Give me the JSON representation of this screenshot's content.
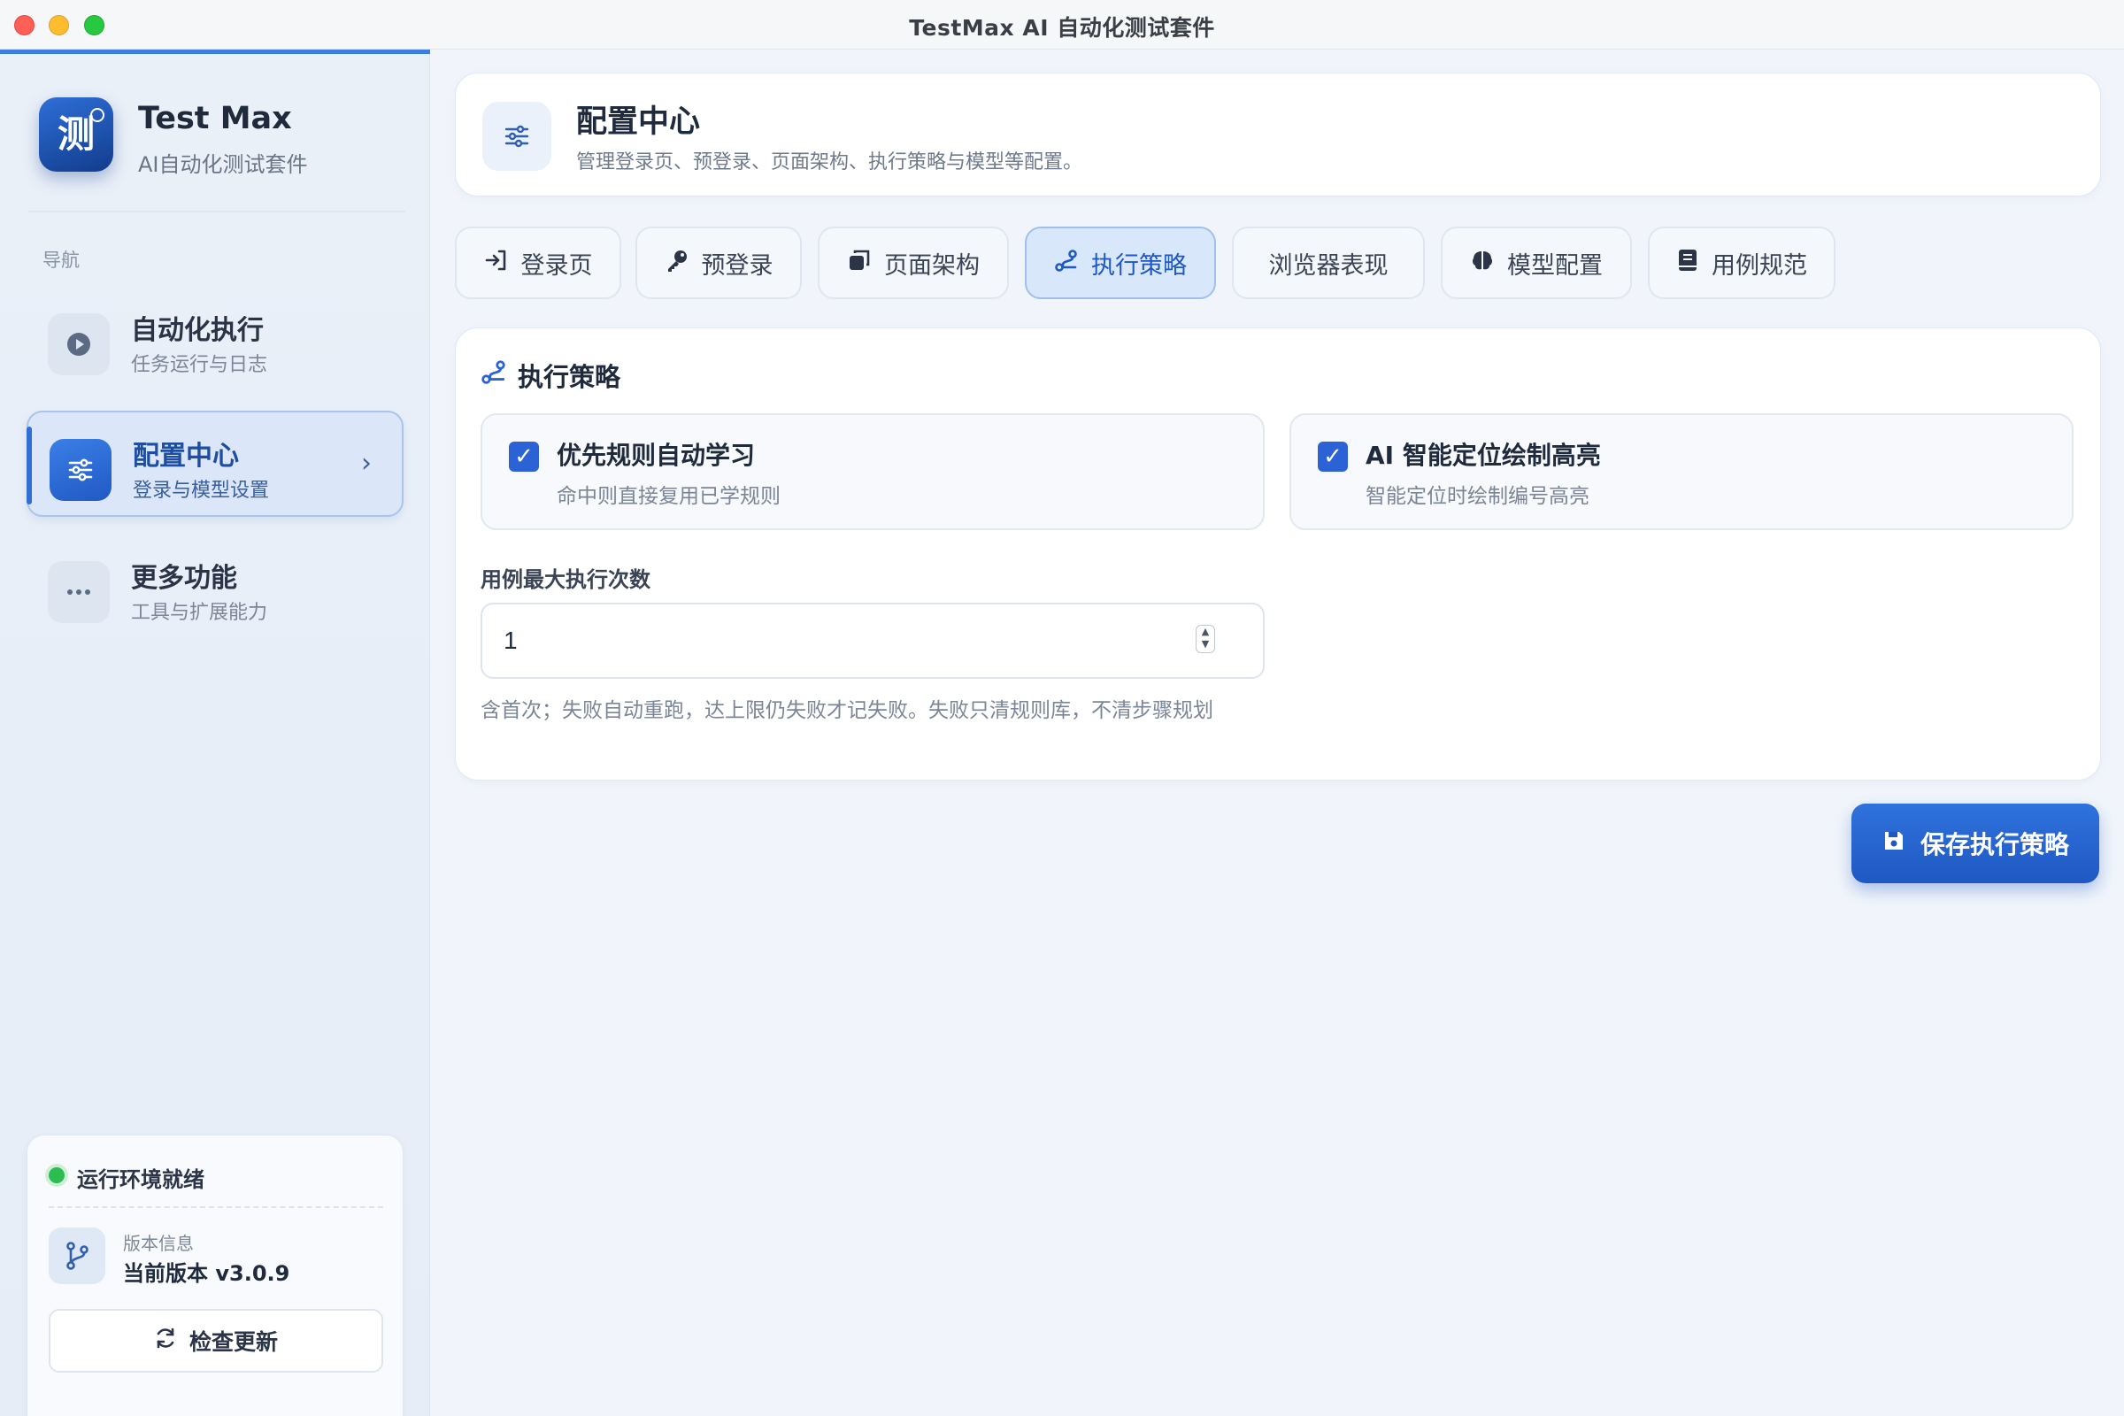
{
  "window": {
    "title": "TestMax AI 自动化测试套件"
  },
  "app": {
    "logo_char": "测",
    "name": "Test Max",
    "subtitle": "AI自动化测试套件"
  },
  "sidebar": {
    "nav_label": "导航",
    "items": [
      {
        "title": "自动化执行",
        "subtitle": "任务运行与日志",
        "icon": "play-icon"
      },
      {
        "title": "配置中心",
        "subtitle": "登录与模型设置",
        "icon": "sliders-icon",
        "active": true
      },
      {
        "title": "更多功能",
        "subtitle": "工具与扩展能力",
        "icon": "more-icon"
      }
    ],
    "status": {
      "text": "运行环境就绪",
      "version_label": "版本信息",
      "version_value": "当前版本 v3.0.9",
      "update_button": "检查更新"
    }
  },
  "header": {
    "title": "配置中心",
    "subtitle": "管理登录页、预登录、页面架构、执行策略与模型等配置。"
  },
  "tabs": [
    {
      "label": "登录页",
      "icon": "sign-in-icon"
    },
    {
      "label": "预登录",
      "icon": "key-icon"
    },
    {
      "label": "页面架构",
      "icon": "copy-icon"
    },
    {
      "label": "执行策略",
      "icon": "route-icon",
      "active": true
    },
    {
      "label": "浏览器表现",
      "icon": ""
    },
    {
      "label": "模型配置",
      "icon": "brain-icon"
    },
    {
      "label": "用例规范",
      "icon": "book-icon"
    }
  ],
  "section": {
    "title": "执行策略",
    "options": [
      {
        "title": "优先规则自动学习",
        "subtitle": "命中则直接复用已学规则",
        "checked": true
      },
      {
        "title": "AI 智能定位绘制高亮",
        "subtitle": "智能定位时绘制编号高亮",
        "checked": true
      }
    ],
    "max_runs_label": "用例最大执行次数",
    "max_runs_value": "1",
    "hint": "含首次；失败自动重跑，达上限仍失败才记失败。失败只清规则库，不清步骤规划"
  },
  "save_button": "保存执行策略",
  "colors": {
    "accent": "#2b63d6",
    "status_ok": "#2bbd4f"
  }
}
